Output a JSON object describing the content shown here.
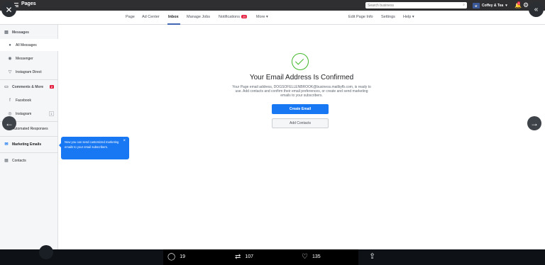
{
  "topbar": {
    "title": "Pages",
    "search_placeholder": "Search business",
    "account_name": "Coffey & Tea",
    "notification_count": "3"
  },
  "pagenav": {
    "items": [
      "Page",
      "Ad Center",
      "Inbox",
      "Manage Jobs",
      "Notifications",
      "More ▾"
    ],
    "notifications_badge": "20",
    "right_items": [
      "Edit Page Info",
      "Settings",
      "Help ▾"
    ]
  },
  "sidebar": {
    "messages": "Messages",
    "all_messages": "All Messages",
    "messenger": "Messenger",
    "instagram_direct": "Instagram Direct",
    "comments": "Comments & More",
    "comments_badge": "2",
    "facebook": "Facebook",
    "instagram": "Instagram",
    "instagram_count": "1",
    "automated": "Automated Responses",
    "marketing": "Marketing Emails",
    "contacts": "Contacts"
  },
  "tooltip": {
    "text": "Now you can send customized marketing emails to your email subscribers."
  },
  "main": {
    "title": "Your Email Address Is Confirmed",
    "body": "Your Page email address, DOGSOFELLENBROOK@business.mailbyfb.com, is ready to use. Add contacts and confirm their email preferences, or create and send marketing emails to your subscribers.",
    "create_email": "Create Email",
    "add_contacts": "Add Contacts"
  },
  "actions": {
    "replies": "19",
    "retweets": "107",
    "likes": "135"
  }
}
